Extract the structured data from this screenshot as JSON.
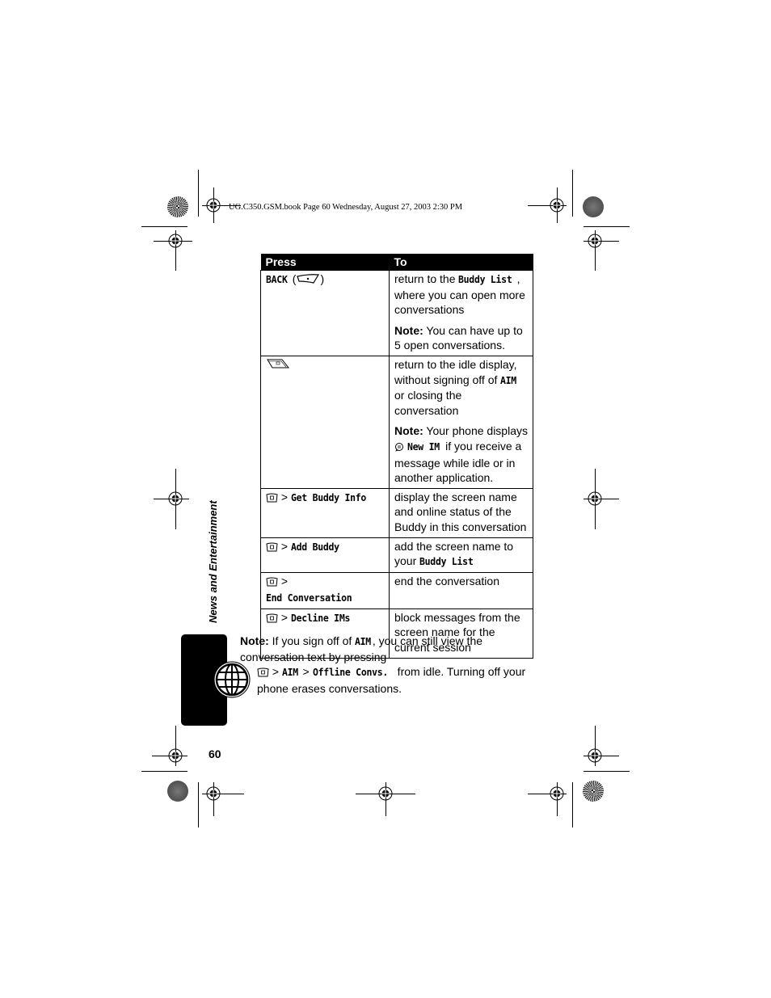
{
  "print_header": "UG.C350.GSM.book  Page 60  Wednesday, August 27, 2003  2:30 PM",
  "side_title": "News and Entertainment",
  "page_number": "60",
  "table": {
    "headers": {
      "press": "Press",
      "to": "To"
    },
    "rows": [
      {
        "press": {
          "label": "BACK",
          "key_icon": "right-soft-key-icon",
          "open": " (",
          "close": ")"
        },
        "to": [
          {
            "pre": "return to the ",
            "term": "Buddy List",
            "post": ", where you can open more conversations"
          },
          {
            "note_label": "Note:",
            "text": " You can have up to 5 open conversations."
          }
        ]
      },
      {
        "press": {
          "key_icon": "end-key-icon"
        },
        "to": [
          {
            "pre": "return to the idle display, without signing off of ",
            "term": "AIM",
            "post": " or closing the conversation"
          },
          {
            "note_label": "Note:",
            "pre": " Your phone displays ",
            "icon": "new-im-icon",
            "term": "New IM",
            "post": " if you receive a message while idle or in another application."
          }
        ]
      },
      {
        "press": {
          "key_icon": "menu-key-icon",
          "sep": " > ",
          "term": "Get Buddy Info"
        },
        "to": [
          {
            "text": "display the screen name and online status of the Buddy in this conversation"
          }
        ]
      },
      {
        "press": {
          "key_icon": "menu-key-icon",
          "sep": " > ",
          "term": "Add Buddy"
        },
        "to": [
          {
            "pre": "add the screen name to your ",
            "term": "Buddy List"
          }
        ]
      },
      {
        "press": {
          "key_icon": "menu-key-icon",
          "sep": " > ",
          "term": "End Conversation"
        },
        "to": [
          {
            "text": "end the conversation"
          }
        ]
      },
      {
        "press": {
          "key_icon": "menu-key-icon",
          "sep": " > ",
          "term": "Decline IMs"
        },
        "to": [
          {
            "text": "block messages from the screen name for the current session"
          }
        ]
      }
    ]
  },
  "note": {
    "label": "Note:",
    "part1": " If you sign off of ",
    "term1": "AIM",
    "part2": ", you can still view the conversation text by pressing",
    "sep1": " > ",
    "term2": "AIM",
    "sep2": " > ",
    "term3": "Offline Convs.",
    "part3": " from idle. Turning off your phone erases conversations."
  }
}
